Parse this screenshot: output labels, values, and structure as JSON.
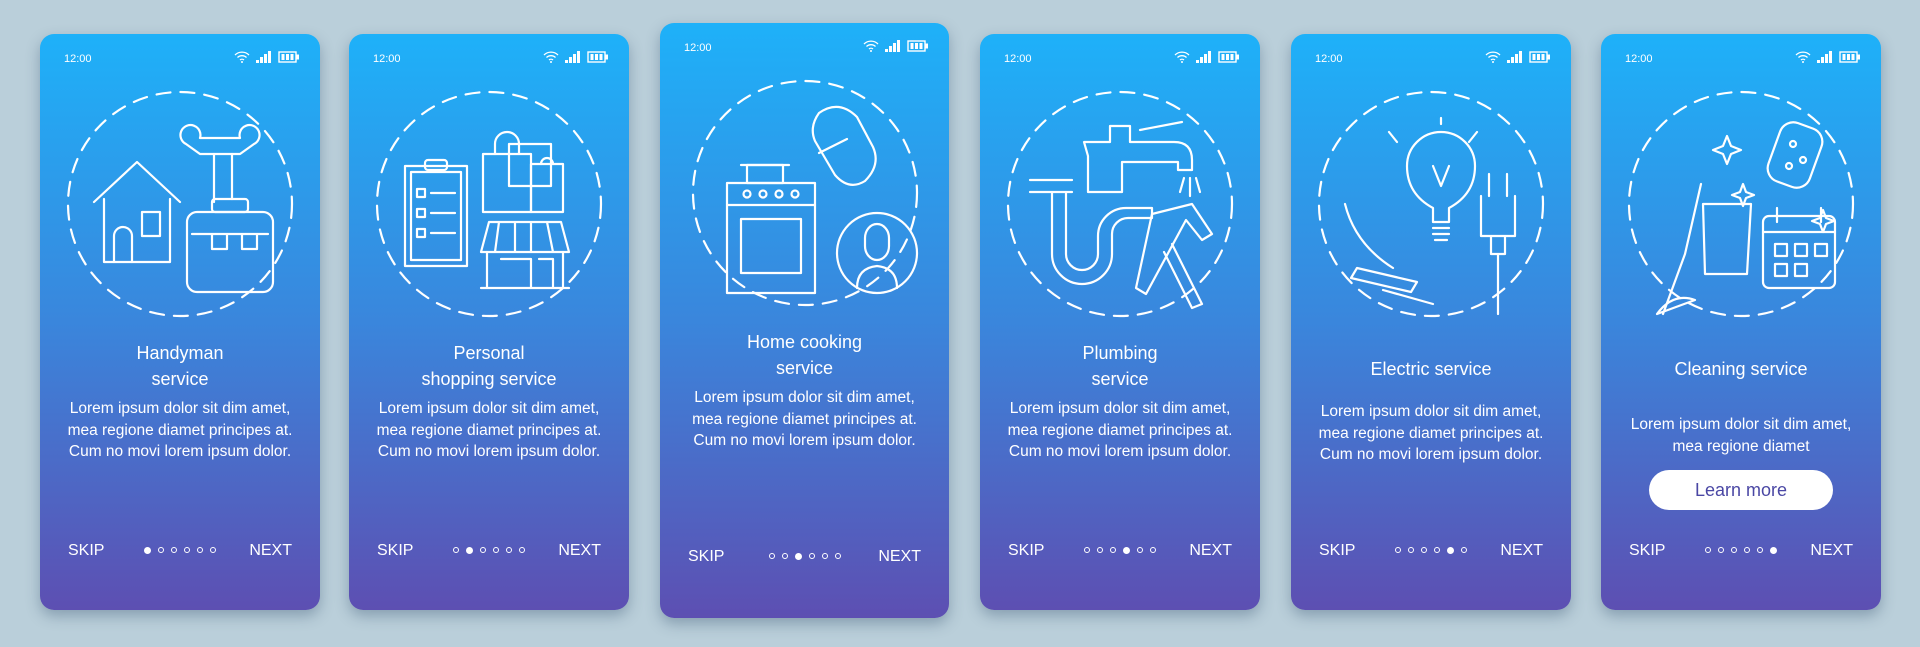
{
  "colors": {
    "background": "#bacfda",
    "gradient_top": "#1eb1f9",
    "gradient_bottom": "#5d4fb2",
    "button_text": "#4a47a4"
  },
  "status_bar": {
    "time": "12:00",
    "icons": [
      "wifi-icon",
      "signal-icon",
      "battery-icon"
    ]
  },
  "nav": {
    "skip_label": "SKIP",
    "next_label": "NEXT",
    "total_pages": 6
  },
  "screens": [
    {
      "title_lines": [
        "Handyman",
        "service"
      ],
      "body": "Lorem ipsum dolor sit dim amet, mea regione diamet principes at. Cum no movi lorem ipsum dolor.",
      "active_page": 1,
      "illustration": "handyman-illustration"
    },
    {
      "title_lines": [
        "Personal",
        "shopping service"
      ],
      "body": "Lorem ipsum dolor sit dim amet, mea regione diamet principes at. Cum no movi lorem ipsum dolor.",
      "active_page": 2,
      "illustration": "shopping-illustration"
    },
    {
      "title_lines": [
        "Home cooking",
        "service"
      ],
      "body": "Lorem ipsum dolor sit dim amet, mea regione diamet principes at. Cum no movi lorem ipsum dolor.",
      "active_page": 3,
      "illustration": "cooking-illustration"
    },
    {
      "title_lines": [
        "Plumbing",
        "service"
      ],
      "body": "Lorem ipsum dolor sit dim amet, mea regione diamet principes at. Cum no movi lorem ipsum dolor.",
      "active_page": 4,
      "illustration": "plumbing-illustration"
    },
    {
      "title_lines": [
        "Electric service"
      ],
      "body": "Lorem ipsum dolor sit dim amet, mea regione diamet principes at. Cum no movi lorem ipsum dolor.",
      "active_page": 5,
      "illustration": "electric-illustration"
    },
    {
      "title_lines": [
        "Cleaning service"
      ],
      "body": "Lorem ipsum dolor sit dim amet, mea regione diamet",
      "active_page": 6,
      "illustration": "cleaning-illustration",
      "button_label": "Learn more"
    }
  ]
}
